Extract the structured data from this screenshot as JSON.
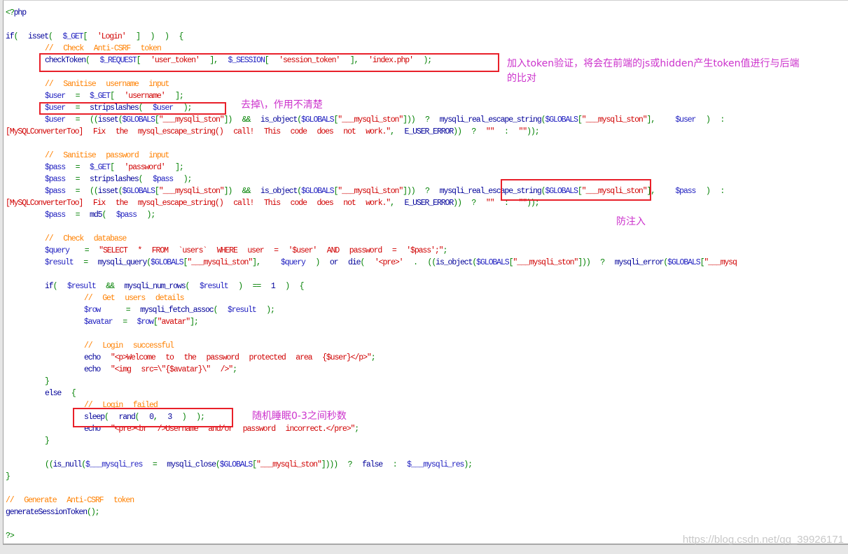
{
  "colors": {
    "comment": "#ff8000",
    "string": "#d00000",
    "variable": "#2020c0",
    "function": "#000099",
    "operator": "#008000",
    "annotation": "#cc33cc",
    "highlight_box": "#e8202a"
  },
  "code_lines": [
    {
      "text": "<?php"
    },
    {
      "text": ""
    },
    {
      "text": "if(  isset(  $_GET[  'Login'  ]  )  )  {"
    },
    {
      "text": "\t//  Check  Anti-CSRF  token"
    },
    {
      "text": "\tcheckToken(  $_REQUEST[  'user_token'  ],  $_SESSION[  'session_token'  ],  'index.php'  );"
    },
    {
      "text": ""
    },
    {
      "text": "\t//  Sanitise  username  input"
    },
    {
      "text": "\t$user  =  $_GET[  'username'  ];"
    },
    {
      "text": "\t$user  =  stripslashes(  $user  );"
    },
    {
      "text": "\t$user  =  ((isset($GLOBALS[\"___mysqli_ston\"])  &&  is_object($GLOBALS[\"___mysqli_ston\"]))  ?  mysqli_real_escape_string($GLOBALS[\"___mysqli_ston\"],    $user  )  :"
    },
    {
      "text": "[MySQLConverterToo]  Fix  the  mysql_escape_string()  call!  This  code  does  not  work.\",  E_USER_ERROR))  ?  \"\"  :  \"\"));",
      "in_string": true
    },
    {
      "text": ""
    },
    {
      "text": "\t//  Sanitise  password  input"
    },
    {
      "text": "\t$pass  =  $_GET[  'password'  ];"
    },
    {
      "text": "\t$pass  =  stripslashes(  $pass  );"
    },
    {
      "text": "\t$pass  =  ((isset($GLOBALS[\"___mysqli_ston\"])  &&  is_object($GLOBALS[\"___mysqli_ston\"]))  ?  mysqli_real_escape_string($GLOBALS[\"___mysqli_ston\"],    $pass  )  :"
    },
    {
      "text": "[MySQLConverterToo]  Fix  the  mysql_escape_string()  call!  This  code  does  not  work.\",  E_USER_ERROR))  ?  \"\"  :  \"\"));",
      "in_string": true
    },
    {
      "text": "\t$pass  =  md5(  $pass  );"
    },
    {
      "text": ""
    },
    {
      "text": "\t//  Check  database"
    },
    {
      "text": "\t$query   =  \"SELECT  *  FROM  `users`  WHERE  user  =  '$user'  AND  password  =  '$pass';\";"
    },
    {
      "text": "\t$result  =  mysqli_query($GLOBALS[\"___mysqli_ston\"],    $query  )  or  die(  '<pre>'  .  ((is_object($GLOBALS[\"___mysqli_ston\"]))  ?  mysqli_error($GLOBALS[\"___mysq"
    },
    {
      "text": ""
    },
    {
      "text": "\tif(  $result  &&  mysqli_num_rows(  $result  )  ==  1  )  {"
    },
    {
      "text": "\t\t//  Get  users  details"
    },
    {
      "text": "\t\t$row     =  mysqli_fetch_assoc(  $result  );"
    },
    {
      "text": "\t\t$avatar  =  $row[\"avatar\"];"
    },
    {
      "text": ""
    },
    {
      "text": "\t\t//  Login  successful"
    },
    {
      "text": "\t\techo  \"<p>Welcome  to  the  password  protected  area  {$user}</p>\";"
    },
    {
      "text": "\t\techo  \"<img  src=\\\"{$avatar}\\\"  />\";"
    },
    {
      "text": "\t}"
    },
    {
      "text": "\telse  {"
    },
    {
      "text": "\t\t//  Login  failed"
    },
    {
      "text": "\t\tsleep(  rand(  0,  3  )  );"
    },
    {
      "text": "\t\techo  \"<pre><br  />Username  and/or  password  incorrect.</pre>\";"
    },
    {
      "text": "\t}"
    },
    {
      "text": ""
    },
    {
      "text": "\t((is_null($___mysqli_res  =  mysqli_close($GLOBALS[\"___mysqli_ston\"])))  ?  false  :  $___mysqli_res);"
    },
    {
      "text": "}"
    },
    {
      "text": ""
    },
    {
      "text": "//  Generate  Anti-CSRF  token"
    },
    {
      "text": "generateSessionToken();"
    },
    {
      "text": ""
    },
    {
      "text": "?>"
    }
  ],
  "annotations": {
    "token_check_line1": "加入token验证，将会在前端的js或hidden产生token值进行与后端",
    "token_check_line2": "的比对",
    "stripslashes": "去掉\\，作用不清楚",
    "escape": "防注入",
    "sleep": "随机睡眠0-3之间秒数"
  },
  "watermark": "https://blog.csdn.net/qq_39926171"
}
